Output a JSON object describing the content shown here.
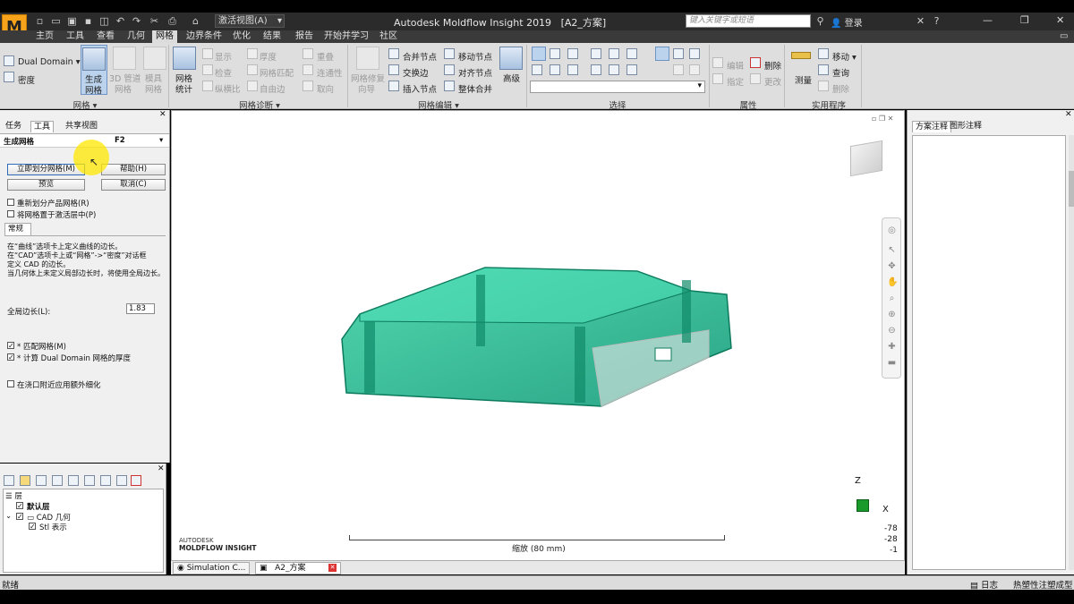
{
  "app": {
    "title": "Autodesk Moldflow Insight 2019",
    "doc": "[A2_方案]",
    "view_select": "激活视图(A)",
    "search_placeholder": "键入关键字或短语",
    "login": "登录",
    "logo_letter": "M"
  },
  "menu": [
    "主页",
    "工具",
    "查看",
    "几何",
    "网格",
    "边界条件",
    "优化",
    "结果",
    "报告",
    "开始并学习",
    "社区"
  ],
  "ribbon": {
    "mesh_group": {
      "dual_domain": "Dual Domain",
      "density": "密度",
      "generate": "生成\n网格",
      "generate_l1": "生成",
      "generate_l2": "网格",
      "pipe_l1": "3D 管道",
      "pipe_l2": "网格",
      "mold_l1": "模具",
      "mold_l2": "网格",
      "title": "网格"
    },
    "diag_group": {
      "stats_l1": "网格",
      "stats_l2": "统计",
      "show": "显示",
      "check": "检查",
      "aspect": "纵横比",
      "thickness": "厚度",
      "match": "网格匹配",
      "free_edge": "自由边",
      "overlap": "重叠",
      "connectivity": "连通性",
      "orientation": "取向",
      "title": "网格诊断"
    },
    "edit_group": {
      "repair_l1": "网格修复",
      "repair_l2": "向导",
      "merge": "合并节点",
      "swap": "交换边",
      "insert": "插入节点",
      "move": "移动节点",
      "align": "对齐节点",
      "global_merge": "整体合并",
      "advanced": "高级",
      "title": "网格编辑"
    },
    "select_group": {
      "title": "选择"
    },
    "prop_group": {
      "edit": "编辑",
      "assign": "指定",
      "delete": "删除",
      "change": "更改",
      "title": "属性"
    },
    "util_group": {
      "measure": "测量",
      "move": "移动",
      "query": "查询",
      "delete": "删除",
      "title": "实用程序"
    }
  },
  "left": {
    "tabs": [
      "任务",
      "工具",
      "共享视图"
    ],
    "title": "生成网格",
    "shortcut": "F2",
    "btn_mesh_now": "立即划分网格(M)",
    "btn_help": "帮助(H)",
    "btn_preview": "预览",
    "btn_cancel": "取消(C)",
    "cb_remesh": "重新划分产品网格(R)",
    "cb_active_layer": "将网格置于激活层中(P)",
    "section_tab": "常规",
    "help_line1": "在“曲线”选项卡上定义曲线的边长。",
    "help_line2": "在“CAD”选项卡上或“网格”->“密度”对话框",
    "help_line3": "定义 CAD 的边长。",
    "help_line4": "当几何体上未定义局部边长时，将使用全局边长。",
    "global_edge_label": "全局边长(L):",
    "global_edge_value": "1.83",
    "cb_match": "* 匹配网格(M)",
    "cb_dual_thickness": "* 计算 Dual Domain 网格的厚度",
    "cb_gate_refine": "在浇口附近应用额外细化"
  },
  "layers": {
    "root": "层",
    "default": "默认层",
    "cad": "CAD 几何",
    "stl": "Stl 表示"
  },
  "viewport": {
    "brand1": "AUTODESK",
    "brand2": "MOLDFLOW INSIGHT",
    "scale": "缩放 (80 mm)",
    "axis_z": "Z",
    "axis_x": "X",
    "coord1": "-78",
    "coord2": "-28",
    "coord3": "-1"
  },
  "doctabs": {
    "tab1": "Simulation C...",
    "tab2": "A2_方案"
  },
  "right": {
    "tabs": [
      "方案注释",
      "图形注释"
    ]
  },
  "status": {
    "left": "就绪",
    "log": "日志",
    "mode": "热塑性注塑成型"
  },
  "colors": {
    "accent": "#f6a21a",
    "part": "#20b48c"
  }
}
